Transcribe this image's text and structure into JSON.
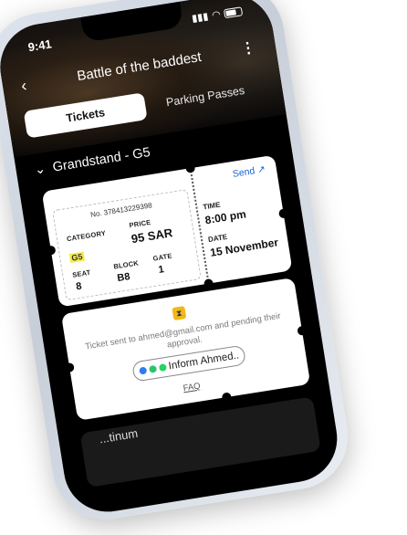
{
  "status": {
    "time": "9:41"
  },
  "header": {
    "title": "Battle of the baddest"
  },
  "tabs": [
    {
      "label": "Tickets"
    },
    {
      "label": "Parking Passes"
    }
  ],
  "section": {
    "label": "Grandstand - G5"
  },
  "ticket": {
    "send_label": "Send",
    "number": "No. 378413229398",
    "category_label": "CATEGORY",
    "category_value": "G5",
    "price_label": "PRICE",
    "price_value": "95 SAR",
    "seat_label": "SEAT",
    "seat_value": "8",
    "block_label": "BLOCK",
    "block_value": "B8",
    "gate_label": "GATE",
    "gate_value": "1",
    "time_label": "TIME",
    "time_value": "8:00 pm",
    "date_label": "DATE",
    "date_value": "15 November"
  },
  "pending": {
    "message": "Ticket sent to ahmed@gmail.com and pending their approval.",
    "inform_label": "Inform Ahmed..",
    "faq_label": "FAQ"
  },
  "next_section": {
    "label": "...tinum"
  },
  "colors": {
    "accent": "#1a66d8",
    "category_chip": "#f3ec4a",
    "hourglass": "#f0b81a"
  }
}
